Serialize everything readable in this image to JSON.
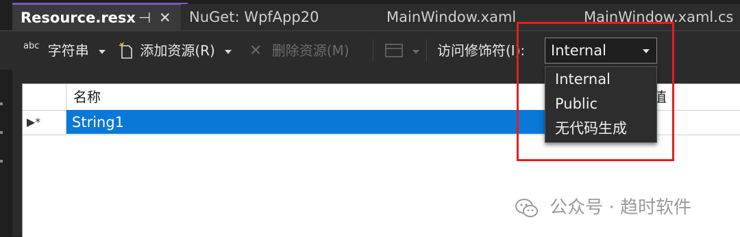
{
  "tabs": [
    {
      "label": "Resource.resx",
      "active": true,
      "pin": "⊣",
      "close": "✕"
    },
    {
      "label": "NuGet: WpfApp20",
      "active": false
    },
    {
      "label": "MainWindow.xaml",
      "active": false
    },
    {
      "label": "MainWindow.xaml.cs",
      "active": false
    }
  ],
  "toolbar": {
    "strings_icon": "abc",
    "strings_label": "字符串",
    "add_label": "添加资源(R)",
    "remove_label": "删除资源(M)",
    "access_label": "访问修饰符(I):",
    "access_value": "Internal"
  },
  "grid": {
    "header_name": "名称",
    "header_value": "值",
    "row_marker": "▶*",
    "rows": [
      {
        "name": "String1"
      }
    ]
  },
  "dropdown": {
    "options": [
      "Internal",
      "Public",
      "无代码生成"
    ]
  },
  "watermark": {
    "text": "公众号 · 趋时软件"
  },
  "colors": {
    "accent": "#7e57c2",
    "selection": "#0a78d7",
    "annotation": "#e41e1e"
  }
}
